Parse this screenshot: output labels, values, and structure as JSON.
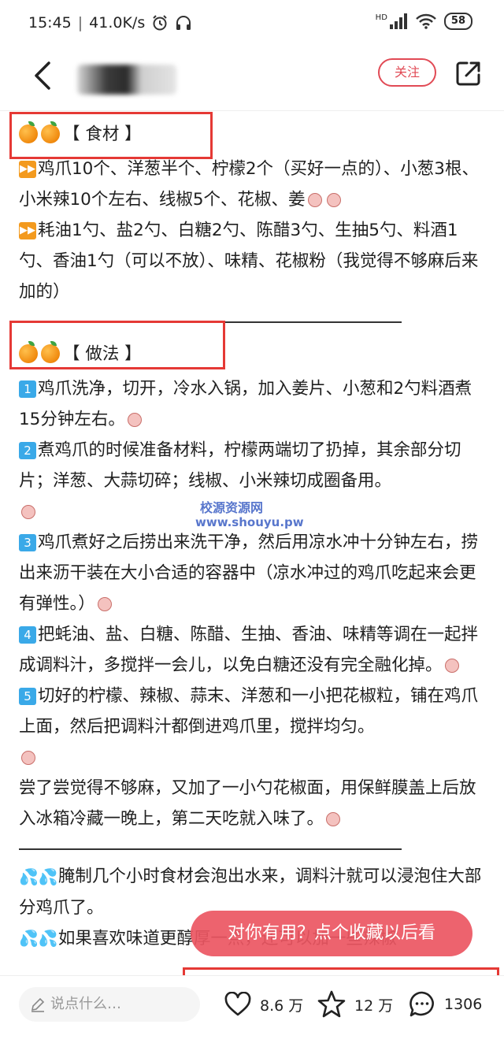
{
  "status_bar": {
    "time": "15:45",
    "separator": "|",
    "network_speed": "41.0K/s",
    "signal_label": "HD",
    "battery": "58"
  },
  "header": {
    "follow_label": "关注"
  },
  "sections": {
    "ingredients_title": "【 食材 】",
    "ingredients_line1": "鸡爪10个、洋葱半个、柠檬2个（买好一点的）、小葱3根、小米辣10个左右、线椒5个、花椒、姜",
    "ingredients_line2": "耗油1勺、盐2勺、白糖2勺、陈醋3勺、生抽5勺、料酒1勺、香油1勺（可以不放）、味精、花椒粉（我觉得不够麻后来加的）",
    "method_title": "【 做法 】",
    "step1_num": "1",
    "step1": "鸡爪洗净，切开，冷水入锅，加入姜片、小葱和2勺料酒煮15分钟左右。",
    "step2_num": "2",
    "step2": "煮鸡爪的时候准备材料，柠檬两端切了扔掉，其余部分切片；洋葱、大蒜切碎；线椒、小米辣切成圈备用。",
    "step3_num": "3",
    "step3": "鸡爪煮好之后捞出来洗干净，然后用凉水冲十分钟左右，捞出来沥干装在大小合适的容器中（凉水冲过的鸡爪吃起来会更有弹性。）",
    "step4_num": "4",
    "step4": "把蚝油、盐、白糖、陈醋、生抽、香油、味精等调在一起拌成调料汁，多搅拌一会儿，以免白糖还没有完全融化掉。",
    "step5_num": "5",
    "step5": "切好的柠檬、辣椒、蒜末、洋葱和一小把花椒粒，铺在鸡爪上面，然后把调料汁都倒进鸡爪里，搅拌均匀。",
    "note": "尝了尝觉得不够麻，又加了一小勺花椒面，用保鲜膜盖上后放入冰箱冷藏一晚上，第二天吃就入味了。",
    "tip1": "腌制几个小时食材会泡出水来，调料汁就可以浸泡住大部分鸡爪了。",
    "tip2": "如果喜欢味道更醇厚一点，还可以加一些辣椒"
  },
  "watermark": {
    "line1": "校源资源网",
    "line2": "www.shouyu.pw"
  },
  "toast": {
    "text": "对你有用？点个收藏以后看"
  },
  "bottom_bar": {
    "comment_placeholder": "说点什么…",
    "likes": "8.6 万",
    "favorites": "12 万",
    "comments": "1306"
  }
}
